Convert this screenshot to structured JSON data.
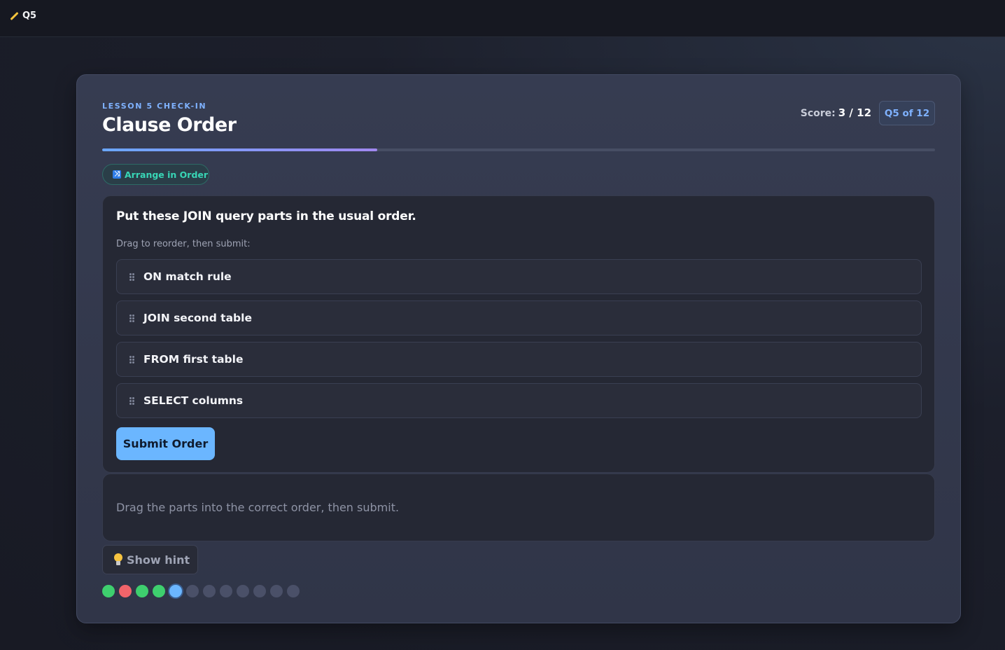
{
  "topbar": {
    "tab_label": "Q5"
  },
  "quiz": {
    "eyebrow": "LESSON 5 CHECK-IN",
    "title": "Clause Order",
    "score_label": "Score:",
    "score_value": "3 / 12",
    "question_badge": "Q5 of 12",
    "progress_fraction": 0.33,
    "type_chip": "Arrange in Order",
    "prompt": "Put these JOIN query parts in the usual order.",
    "instruction": "Drag to reorder, then submit:",
    "items": [
      {
        "label": "ON match rule"
      },
      {
        "label": "JOIN second table"
      },
      {
        "label": "FROM first table"
      },
      {
        "label": "SELECT columns"
      }
    ],
    "submit_label": "Submit Order",
    "feedback": "Drag the parts into the correct order, then submit.",
    "hint_label": "Show hint",
    "question_dots": [
      "correct",
      "wrong",
      "correct",
      "correct",
      "current",
      "pending",
      "pending",
      "pending",
      "pending",
      "pending",
      "pending",
      "pending"
    ]
  },
  "colors": {
    "correct": "#3ecf6e",
    "wrong": "#f0646a",
    "current": "#6bb6ff",
    "pending": "#4a5068",
    "accent": "#7fb2ff",
    "chip": "#38d6b6"
  }
}
